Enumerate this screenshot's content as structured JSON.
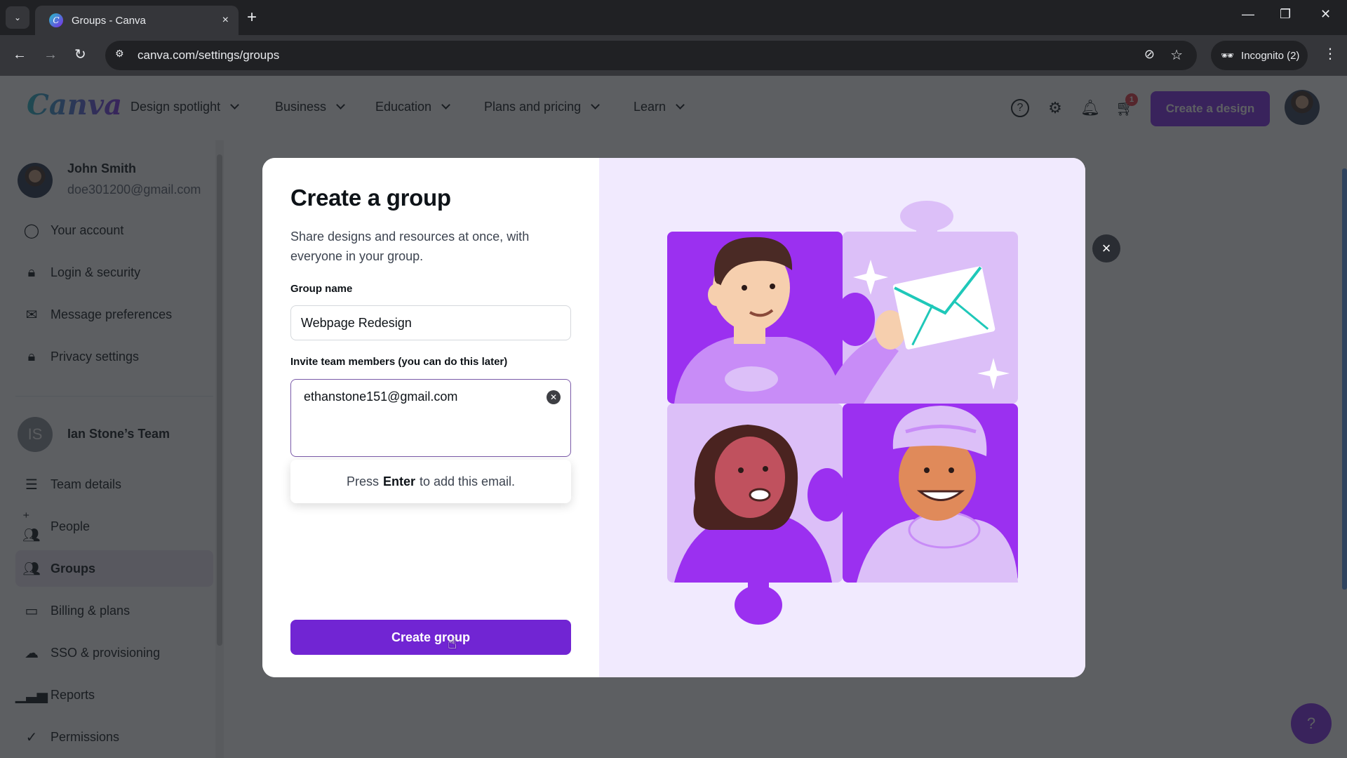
{
  "browser": {
    "tab_title": "Groups - Canva",
    "url": "canva.com/settings/groups",
    "incognito_label": "Incognito (2)",
    "new_tab_icon": "+",
    "tab_close_icon": "×"
  },
  "header": {
    "logo": "Canva",
    "nav": [
      {
        "label": "Design spotlight"
      },
      {
        "label": "Business"
      },
      {
        "label": "Education"
      },
      {
        "label": "Plans and pricing"
      },
      {
        "label": "Learn"
      }
    ],
    "cart_badge": "1",
    "create_design_label": "Create a design"
  },
  "sidebar": {
    "user": {
      "name": "John Smith",
      "email": "doe301200@gmail.com"
    },
    "account_items": [
      {
        "label": "Your account",
        "icon": "user-circle-icon"
      },
      {
        "label": "Login & security",
        "icon": "lock-icon"
      },
      {
        "label": "Message preferences",
        "icon": "mail-icon"
      },
      {
        "label": "Privacy settings",
        "icon": "lock-icon"
      }
    ],
    "team": {
      "initials": "IS",
      "name": "Ian Stone’s Team"
    },
    "team_items": [
      {
        "label": "Team details",
        "icon": "list-icon"
      },
      {
        "label": "People",
        "icon": "add-people-icon"
      },
      {
        "label": "Groups",
        "icon": "groups-icon",
        "active": true
      },
      {
        "label": "Billing & plans",
        "icon": "credit-card-icon"
      },
      {
        "label": "SSO & provisioning",
        "icon": "cloud-upload-icon"
      },
      {
        "label": "Reports",
        "icon": "bar-chart-icon"
      },
      {
        "label": "Permissions",
        "icon": "check-circle-icon"
      }
    ]
  },
  "modal": {
    "title": "Create a group",
    "description": "Share designs and resources at once, with everyone in your group.",
    "group_name_label": "Group name",
    "group_name_value": "Webpage Redesign",
    "invite_label": "Invite team members (you can do this later)",
    "invite_email": "ethanstone151@gmail.com",
    "hint_prefix": "Press",
    "hint_key": "Enter",
    "hint_suffix": "to add this email.",
    "create_button": "Create group",
    "close_icon": "×"
  },
  "help_fab": "?",
  "colors": {
    "brand_purple": "#7d2ae8",
    "button_purple": "#7125d3",
    "illustration_bg": "#f1eafe"
  }
}
